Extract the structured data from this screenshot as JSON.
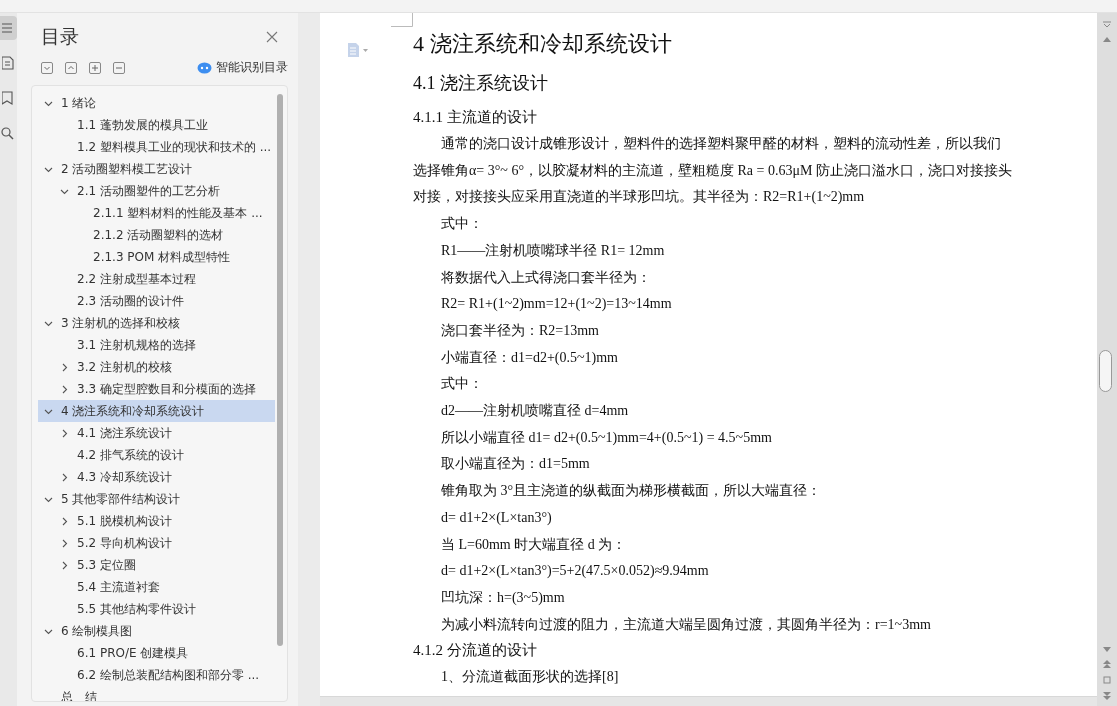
{
  "toc": {
    "title": "目录",
    "smart_label": "智能识别目录",
    "items": [
      {
        "label": "1 绪论",
        "expanded": true,
        "selected": false,
        "children": [
          {
            "label": "1.1 蓬勃发展的模具工业",
            "selected": false
          },
          {
            "label": "1.2 塑料模具工业的现状和技术的 ...",
            "selected": false
          }
        ]
      },
      {
        "label": "2 活动圈塑料模工艺设计",
        "expanded": true,
        "selected": false,
        "children": [
          {
            "label": "2.1 活动圈塑件的工艺分析",
            "expanded": true,
            "selected": false,
            "children": [
              {
                "label": "2.1.1 塑料材料的性能及基本 ...",
                "selected": false
              },
              {
                "label": "2.1.2 活动圈塑料的选材",
                "selected": false
              },
              {
                "label": "2.1.3 POM 材料成型特性",
                "selected": false
              }
            ]
          },
          {
            "label": "2.2 注射成型基本过程",
            "selected": false
          },
          {
            "label": "2.3 活动圈的设计件",
            "selected": false
          }
        ]
      },
      {
        "label": "3 注射机的选择和校核",
        "expanded": true,
        "selected": false,
        "children": [
          {
            "label": "3.1 注射机规格的选择",
            "selected": false
          },
          {
            "label": "3.2 注射机的校核",
            "expanded": false,
            "selected": false
          },
          {
            "label": "3.3 确定型腔数目和分模面的选择",
            "expanded": false,
            "selected": false
          }
        ]
      },
      {
        "label": "4 浇注系统和冷却系统设计",
        "expanded": true,
        "selected": true,
        "children": [
          {
            "label": "4.1 浇注系统设计",
            "expanded": false,
            "selected": false
          },
          {
            "label": "4.2 排气系统的设计",
            "selected": false
          },
          {
            "label": "4.3 冷却系统设计",
            "expanded": false,
            "selected": false
          }
        ]
      },
      {
        "label": "5 其他零部件结构设计",
        "expanded": true,
        "selected": false,
        "children": [
          {
            "label": "5.1 脱模机构设计",
            "expanded": false,
            "selected": false
          },
          {
            "label": "5.2 导向机构设计",
            "expanded": false,
            "selected": false
          },
          {
            "label": "5.3 定位圈",
            "expanded": false,
            "selected": false
          },
          {
            "label": "5.4 主流道衬套",
            "selected": false
          },
          {
            "label": "5.5 其他结构零件设计",
            "selected": false
          }
        ]
      },
      {
        "label": "6 绘制模具图",
        "expanded": true,
        "selected": false,
        "children": [
          {
            "label": "6.1 PRO/E 创建模具",
            "selected": false
          },
          {
            "label": "6.2  绘制总装配结构图和部分零 ...",
            "selected": false
          }
        ]
      },
      {
        "label": "总　结",
        "selected": false
      }
    ]
  },
  "document": {
    "blocks": [
      {
        "kind": "h1",
        "text": "4 浇注系统和冷却系统设计"
      },
      {
        "kind": "h2",
        "text": "4.1 浇注系统设计"
      },
      {
        "kind": "h3",
        "text": "4.1.1 主流道的设计"
      },
      {
        "kind": "para",
        "text": "通常的浇口设计成锥形设计，塑料件的选择塑料聚甲醛的材料，塑料的流动性差，所以我们选择锥角α= 3°~ 6°，以胶凝材料的主流道，壁粗糙度 Ra = 0.63μM 防止浇口溢水口，浇口对接接头对接，对接接头应采用直浇道的半球形凹坑。其半径为：R2=R1+(1~2)mm"
      },
      {
        "kind": "para",
        "text": "式中："
      },
      {
        "kind": "para",
        "text": "R1——注射机喷嘴球半径 R1= 12mm"
      },
      {
        "kind": "para",
        "text": "将数据代入上式得浇口套半径为："
      },
      {
        "kind": "para",
        "text": "R2= R1+(1~2)mm=12+(1~2)=13~14mm"
      },
      {
        "kind": "para",
        "text": "浇口套半径为：R2=13mm"
      },
      {
        "kind": "para",
        "text": "小端直径：d1=d2+(0.5~1)mm"
      },
      {
        "kind": "para",
        "text": "式中："
      },
      {
        "kind": "para",
        "text": "d2——注射机喷嘴直径 d=4mm"
      },
      {
        "kind": "para",
        "text": "所以小端直径 d1= d2+(0.5~1)mm=4+(0.5~1) = 4.5~5mm"
      },
      {
        "kind": "para",
        "text": "取小端直径为：d1=5mm"
      },
      {
        "kind": "para",
        "text": "锥角取为 3°且主浇道的纵截面为梯形横截面，所以大端直径："
      },
      {
        "kind": "para",
        "text": "d= d1+2×(L×tan3°)"
      },
      {
        "kind": "para",
        "text": "当 L=60mm 时大端直径 d 为："
      },
      {
        "kind": "para",
        "text": "d= d1+2×(L×tan3°)=5+2(47.5×0.052)≈9.94mm"
      },
      {
        "kind": "para",
        "text": "凹坑深：h=(3~5)mm"
      },
      {
        "kind": "para",
        "text": "为减小料流转向过渡的阻力，主流道大端呈圆角过渡，其圆角半径为：r=1~3mm"
      },
      {
        "kind": "h3",
        "text": "4.1.2 分流道的设计"
      },
      {
        "kind": "para",
        "text": "1、分流道截面形状的选择[8]"
      }
    ]
  }
}
